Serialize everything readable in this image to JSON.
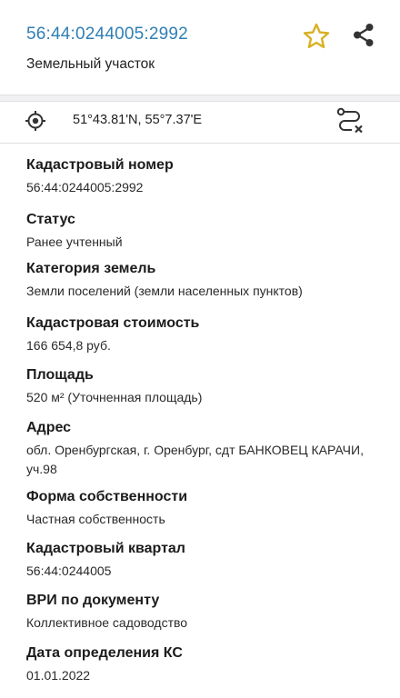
{
  "header": {
    "cadastral_number": "56:44:0244005:2992",
    "object_type": "Земельный участок",
    "star_icon": "star-icon",
    "share_icon": "share-icon",
    "star_color": "#d8b024",
    "link_color": "#2f7fb5"
  },
  "location": {
    "coordinates": "51°43.81'N, 55°7.37'E",
    "left_icon": "gps-target-icon",
    "right_icon": "route-icon"
  },
  "fields": [
    {
      "label": "Кадастровый номер",
      "value": "56:44:0244005:2992"
    },
    {
      "label": "Статус",
      "value": "Ранее учтенный"
    },
    {
      "label": "Категория земель",
      "value": "Земли поселений (земли населенных пунктов)"
    },
    {
      "label": "Кадастровая стоимость",
      "value": "166 654,8 руб."
    },
    {
      "label": "Площадь",
      "value": "520 м² (Уточненная площадь)"
    },
    {
      "label": "Адрес",
      "value": "обл. Оренбургская, г. Оренбург, сдт БАНКОВЕЦ КАРАЧИ, уч.98"
    },
    {
      "label": "Форма собственности",
      "value": "Частная собственность"
    },
    {
      "label": "Кадастровый квартал",
      "value": "56:44:0244005"
    },
    {
      "label": "ВРИ по документу",
      "value": "Коллективное садоводство"
    },
    {
      "label": "Дата определения КС",
      "value": "01.01.2022"
    }
  ]
}
